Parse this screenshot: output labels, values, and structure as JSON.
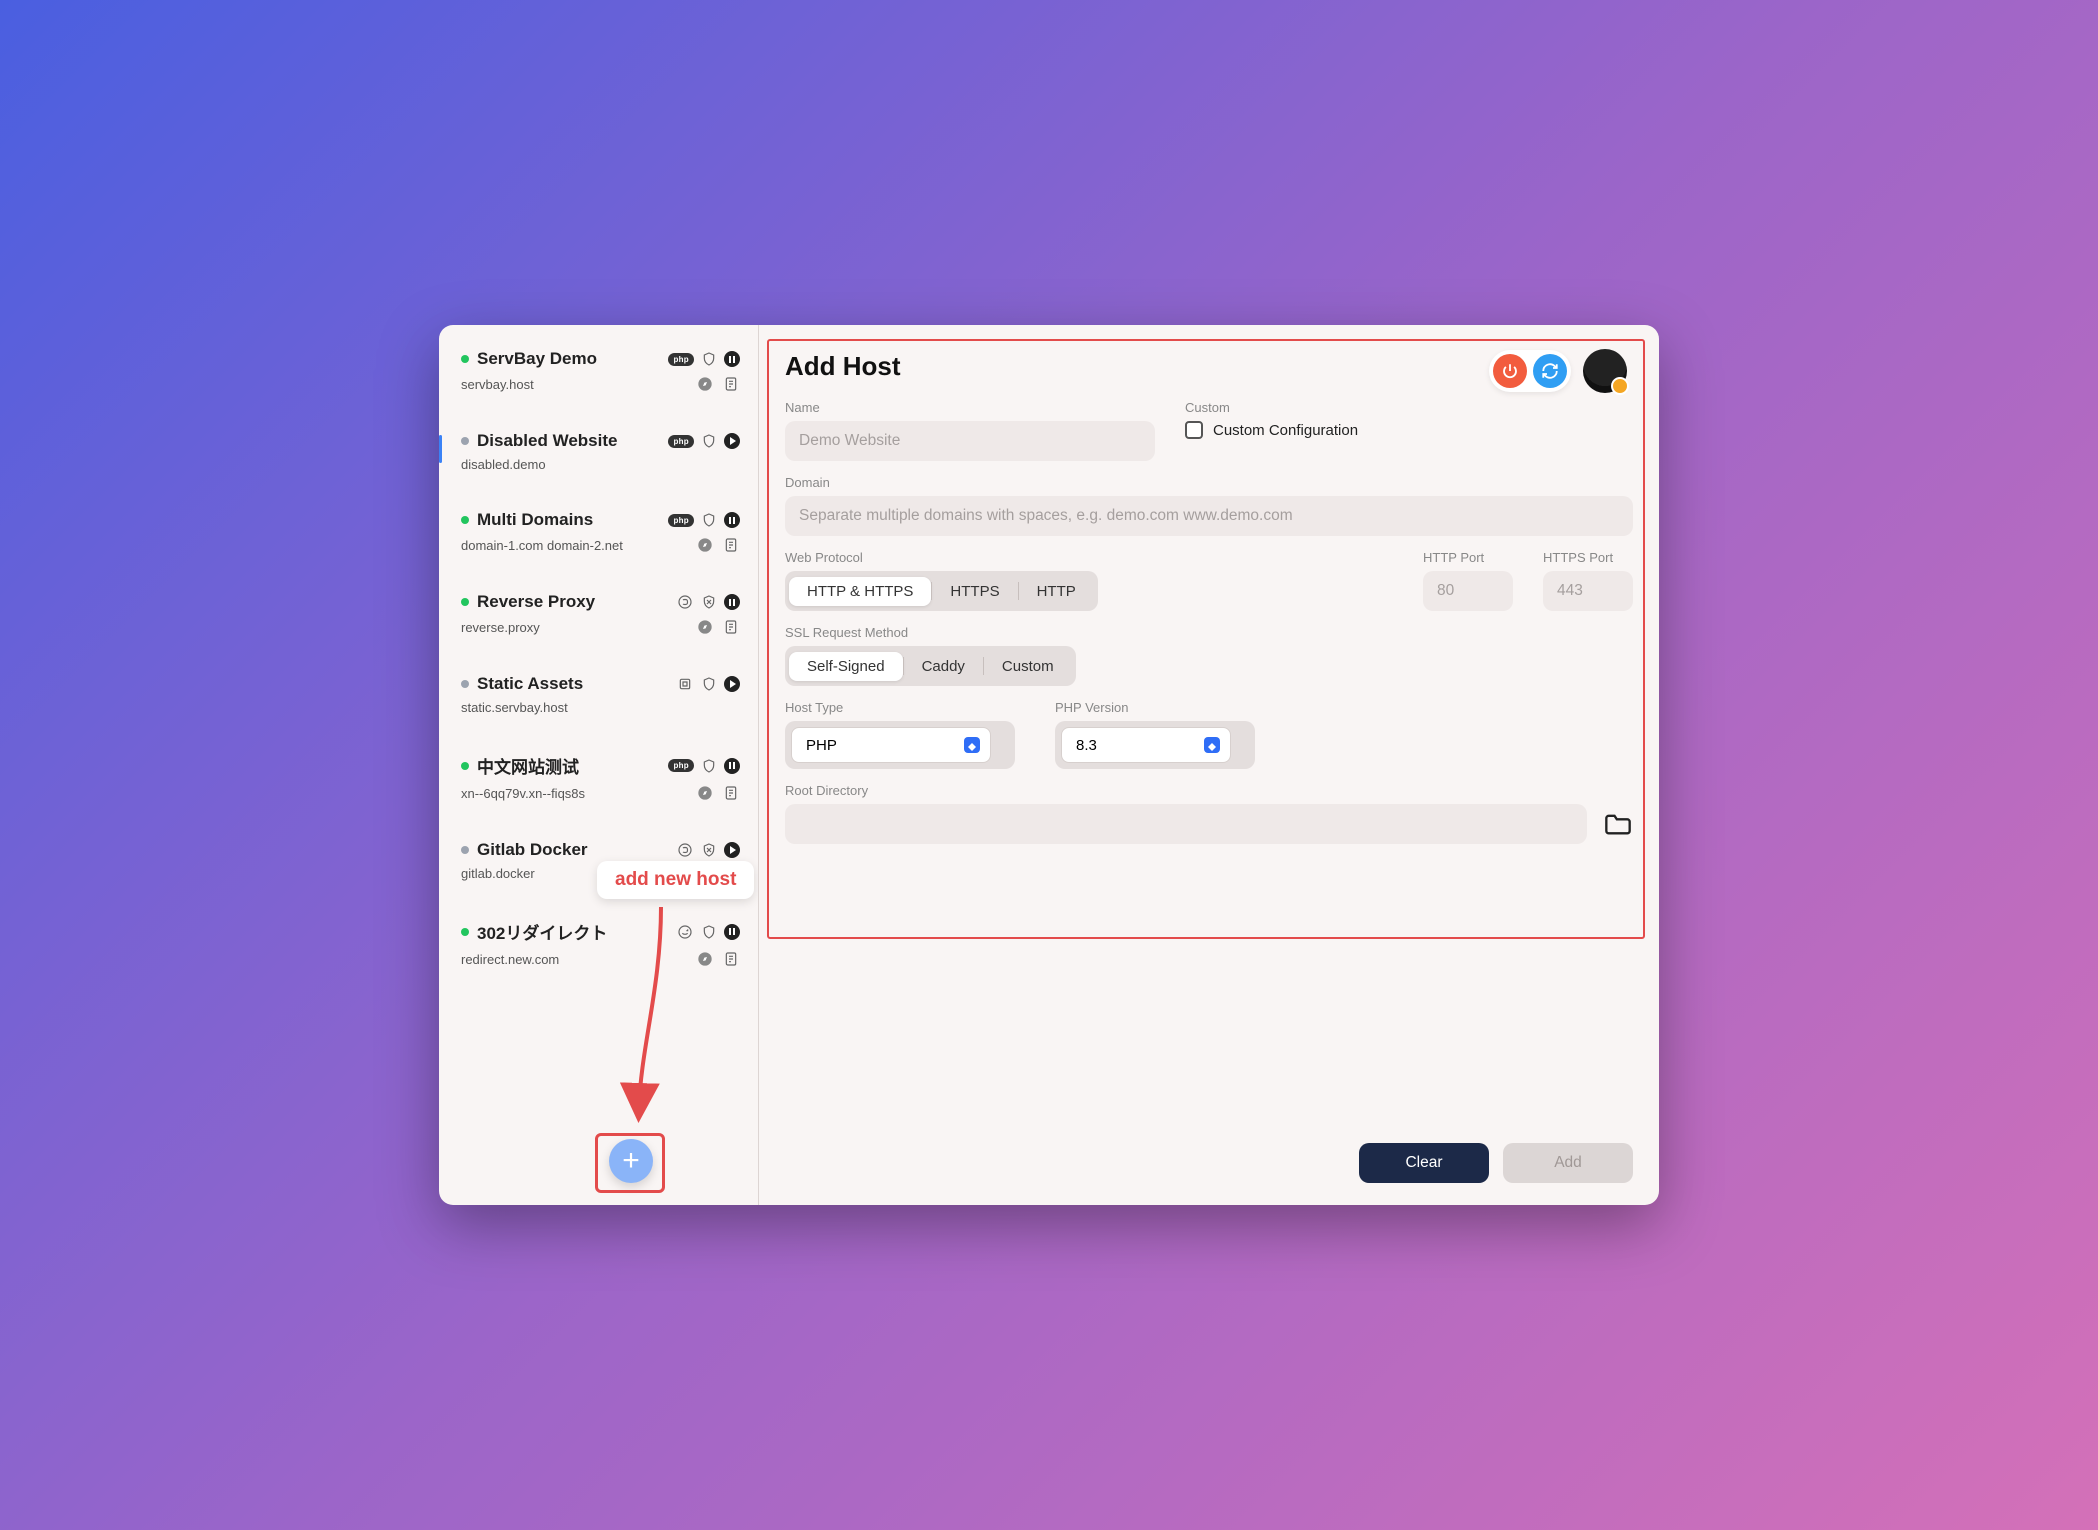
{
  "annotation": {
    "callout": "add new host"
  },
  "sidebar": {
    "items": [
      {
        "name": "ServBay Demo",
        "domain": "servbay.host",
        "status": "green",
        "type": "php",
        "running": "pause",
        "row2_icons": [
          "compass",
          "note"
        ]
      },
      {
        "name": "Disabled Website",
        "domain": "disabled.demo",
        "status": "grey",
        "type": "php",
        "running": "play",
        "row2_icons": []
      },
      {
        "name": "Multi Domains",
        "domain": "domain-1.com domain-2.net",
        "status": "green",
        "type": "php",
        "running": "pause",
        "row2_icons": [
          "compass",
          "note"
        ]
      },
      {
        "name": "Reverse Proxy",
        "domain": "reverse.proxy",
        "status": "green",
        "type": "proxy",
        "running": "pause",
        "row2_icons": [
          "compass",
          "note"
        ]
      },
      {
        "name": "Static Assets",
        "domain": "static.servbay.host",
        "status": "grey",
        "type": "static",
        "running": "play",
        "row2_icons": []
      },
      {
        "name": "中文网站测试",
        "domain": "xn--6qq79v.xn--fiqs8s",
        "status": "green",
        "type": "php",
        "running": "pause",
        "row2_icons": [
          "compass",
          "note"
        ]
      },
      {
        "name": "Gitlab Docker",
        "domain": "gitlab.docker",
        "status": "grey",
        "type": "proxy",
        "running": "play",
        "row2_icons": []
      },
      {
        "name": "302リダイレクト",
        "domain": "redirect.new.com",
        "status": "green",
        "type": "redirect",
        "running": "pause",
        "row2_icons": [
          "compass",
          "note"
        ]
      }
    ]
  },
  "main": {
    "title": "Add Host",
    "labels": {
      "name": "Name",
      "custom": "Custom",
      "custom_config": "Custom Configuration",
      "domain": "Domain",
      "web_protocol": "Web Protocol",
      "http_port": "HTTP Port",
      "https_port": "HTTPS Port",
      "ssl_method": "SSL Request Method",
      "host_type": "Host Type",
      "php_version": "PHP Version",
      "root_directory": "Root Directory"
    },
    "placeholders": {
      "name": "Demo Website",
      "domain": "Separate multiple domains with spaces, e.g. demo.com www.demo.com",
      "http_port": "80",
      "https_port": "443"
    },
    "segments": {
      "protocol": [
        "HTTP & HTTPS",
        "HTTPS",
        "HTTP"
      ],
      "ssl": [
        "Self-Signed",
        "Caddy",
        "Custom"
      ]
    },
    "selects": {
      "host_type": "PHP",
      "php_version": "8.3"
    },
    "buttons": {
      "clear": "Clear",
      "add": "Add"
    }
  }
}
